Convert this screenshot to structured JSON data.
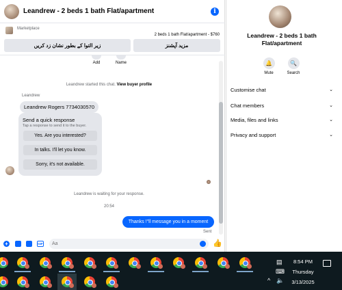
{
  "chat": {
    "title": "Leandrew - 2 beds 1 bath Flat/apartment",
    "info_icon": "info-icon"
  },
  "marketplace": {
    "label": "Marketplace",
    "listing": "2 beds 1 bath Flat/apartment - $760",
    "btn_left": "زیر التوا کے بطور نشان زد کریں",
    "btn_right": "مزید آپشنز"
  },
  "messages": {
    "add_label": "Add",
    "name_label": "Name",
    "started_text": "Leandrew started this chat.",
    "view_profile": "View buyer profile",
    "sender": "Leandrew",
    "phone_msg": "Leandrew Rogers 7734030570",
    "quick_title": "Send a quick response",
    "quick_sub": "Tap a response to send it to the buyer.",
    "quick_options": [
      "Yes. Are you interested?",
      "In talks. I'll let you know.",
      "Sorry, it's not available."
    ],
    "waiting": "Leandrew is waiting for your response.",
    "time": "20:54",
    "outgoing": "Thanks !\"ll message you in a moment",
    "sent": "Sent"
  },
  "composer": {
    "placeholder": "Aa",
    "value": ""
  },
  "side": {
    "name": "Leandrew - 2 beds 1 bath Flat/apartment",
    "mute": "Mute",
    "search": "Search",
    "rows": [
      "Customise chat",
      "Chat members",
      "Media, files and links",
      "Privacy and support"
    ]
  },
  "taskbar": {
    "time": "8:54 PM",
    "day": "Thursday",
    "date": "3/13/2025"
  },
  "colors": {
    "accent": "#0866ff",
    "bubble_in": "#e4e6eb",
    "taskbar_bg": "#0e1a1f"
  }
}
